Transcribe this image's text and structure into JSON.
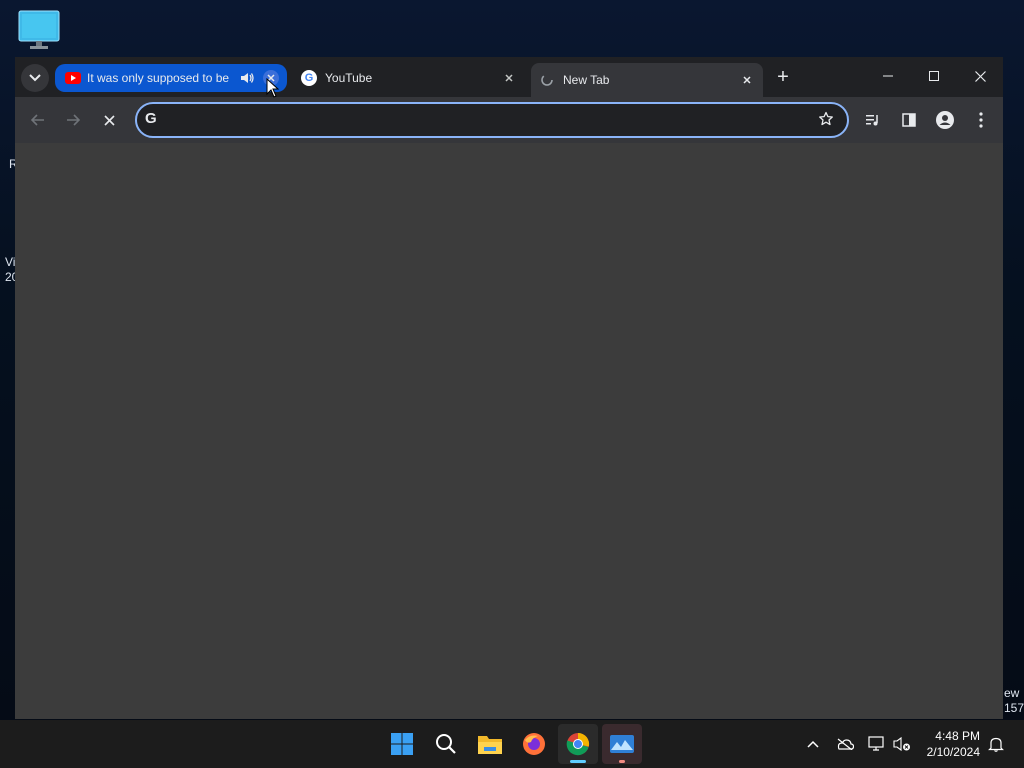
{
  "desktop": {
    "left_clipped_texts": [
      "R",
      "Vi",
      "20"
    ],
    "right_clipped_texts": [
      "ew",
      "157"
    ]
  },
  "browser": {
    "tabs": [
      {
        "title": "It was only supposed to be",
        "favicon": "youtube-icon",
        "audio": "speaker-icon",
        "group_color": "#0b57d0"
      },
      {
        "title": "YouTube",
        "favicon": "google-g-icon"
      },
      {
        "title": "New Tab",
        "favicon": "loading-icon",
        "active": true
      }
    ],
    "new_tab_symbol": "+",
    "window_controls": {
      "minimize": "minimize-icon",
      "maximize": "maximize-icon",
      "close": "close-icon"
    },
    "omnibox": {
      "value": "",
      "placeholder": ""
    },
    "colors": {
      "frame": "#202124",
      "toolbar": "#35363a",
      "content": "#3c3c3c",
      "focus_ring": "#8ab4f8"
    }
  },
  "taskbar": {
    "apps": [
      "start-icon",
      "search-icon",
      "file-explorer-icon",
      "firefox-icon",
      "chrome-icon",
      "photos-icon"
    ],
    "tray": [
      "chevron-up-icon",
      "onedrive-icon",
      "network-icon",
      "volume-muted-icon"
    ],
    "time": "4:48 PM",
    "date": "2/10/2024"
  }
}
